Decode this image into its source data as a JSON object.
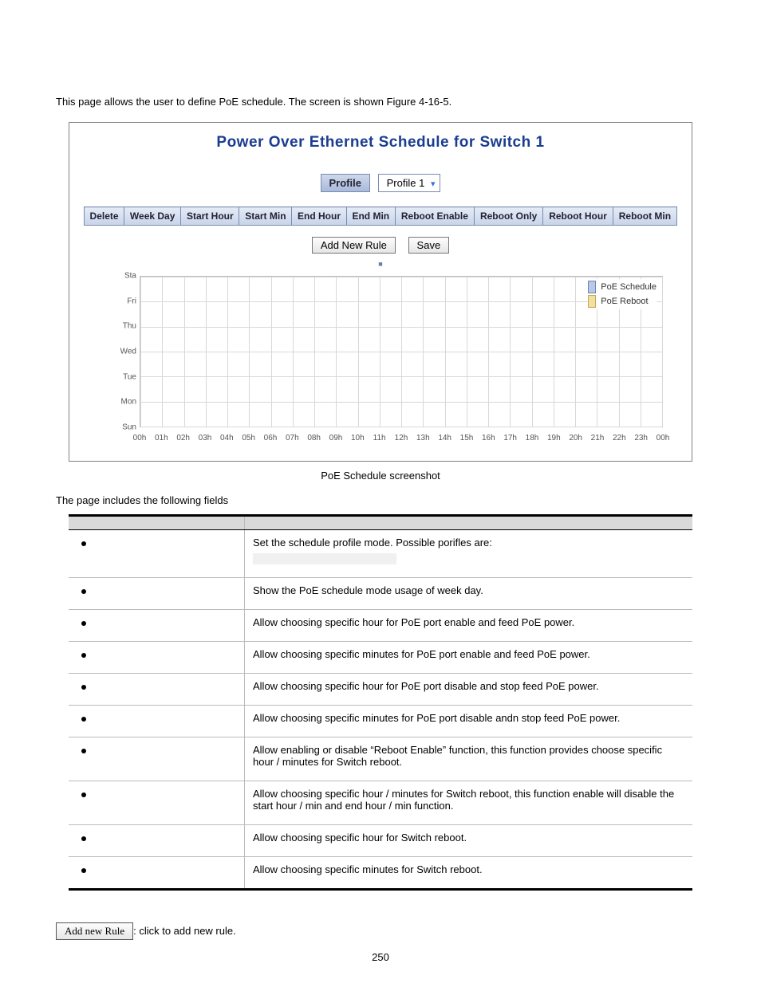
{
  "intro": "This page allows the user to define PoE schedule. The screen is shown Figure 4-16-5.",
  "panel": {
    "title": "Power Over Ethernet Schedule  for Switch 1",
    "profile_label": "Profile",
    "profile_value": "Profile 1",
    "columns": [
      "Delete",
      "Week Day",
      "Start Hour",
      "Start Min",
      "End Hour",
      "End Min",
      "Reboot Enable",
      "Reboot Only",
      "Reboot Hour",
      "Reboot Min"
    ],
    "btn_add": "Add New Rule",
    "btn_save": "Save",
    "legend_schedule": "PoE Schedule",
    "legend_reboot": "PoE Reboot"
  },
  "chart_data": {
    "type": "heatmap",
    "title": "",
    "y_categories": [
      "Sta",
      "Fri",
      "Thu",
      "Wed",
      "Tue",
      "Mon",
      "Sun"
    ],
    "x_categories": [
      "00h",
      "01h",
      "02h",
      "03h",
      "04h",
      "05h",
      "06h",
      "07h",
      "08h",
      "09h",
      "10h",
      "11h",
      "12h",
      "13h",
      "14h",
      "15h",
      "16h",
      "17h",
      "18h",
      "19h",
      "20h",
      "21h",
      "22h",
      "23h",
      "00h"
    ],
    "series": [
      {
        "name": "PoE Schedule",
        "values": []
      },
      {
        "name": "PoE Reboot",
        "values": []
      }
    ],
    "xlabel": "",
    "ylabel": ""
  },
  "caption": "PoE Schedule screenshot",
  "fields_intro": "The page includes the following fields",
  "fields": [
    {
      "desc": "Set the schedule profile mode. Possible porifles are:",
      "has_blank": true
    },
    {
      "desc": "Show the PoE schedule mode usage of week day."
    },
    {
      "desc": "Allow choosing specific hour for PoE port enable and feed PoE power."
    },
    {
      "desc": "Allow choosing specific minutes for PoE port enable and feed PoE power."
    },
    {
      "desc": "Allow choosing specific hour for PoE port disable and stop feed PoE power."
    },
    {
      "desc": "Allow choosing specific minutes for PoE port disable andn stop feed PoE power."
    },
    {
      "desc": "Allow enabling or disable “Reboot Enable” function, this function provides choose specific hour / minutes for Switch reboot."
    },
    {
      "desc": "Allow choosing specific hour / minutes for Switch reboot, this function enable will disable the start hour / min and end hour / min function."
    },
    {
      "desc": "Allow choosing specific hour for Switch reboot."
    },
    {
      "desc": "Allow choosing specific minutes for Switch reboot."
    }
  ],
  "footer": {
    "mini_btn": "Add new Rule",
    "mini_text": ": click to add new rule."
  },
  "page_number": "250"
}
